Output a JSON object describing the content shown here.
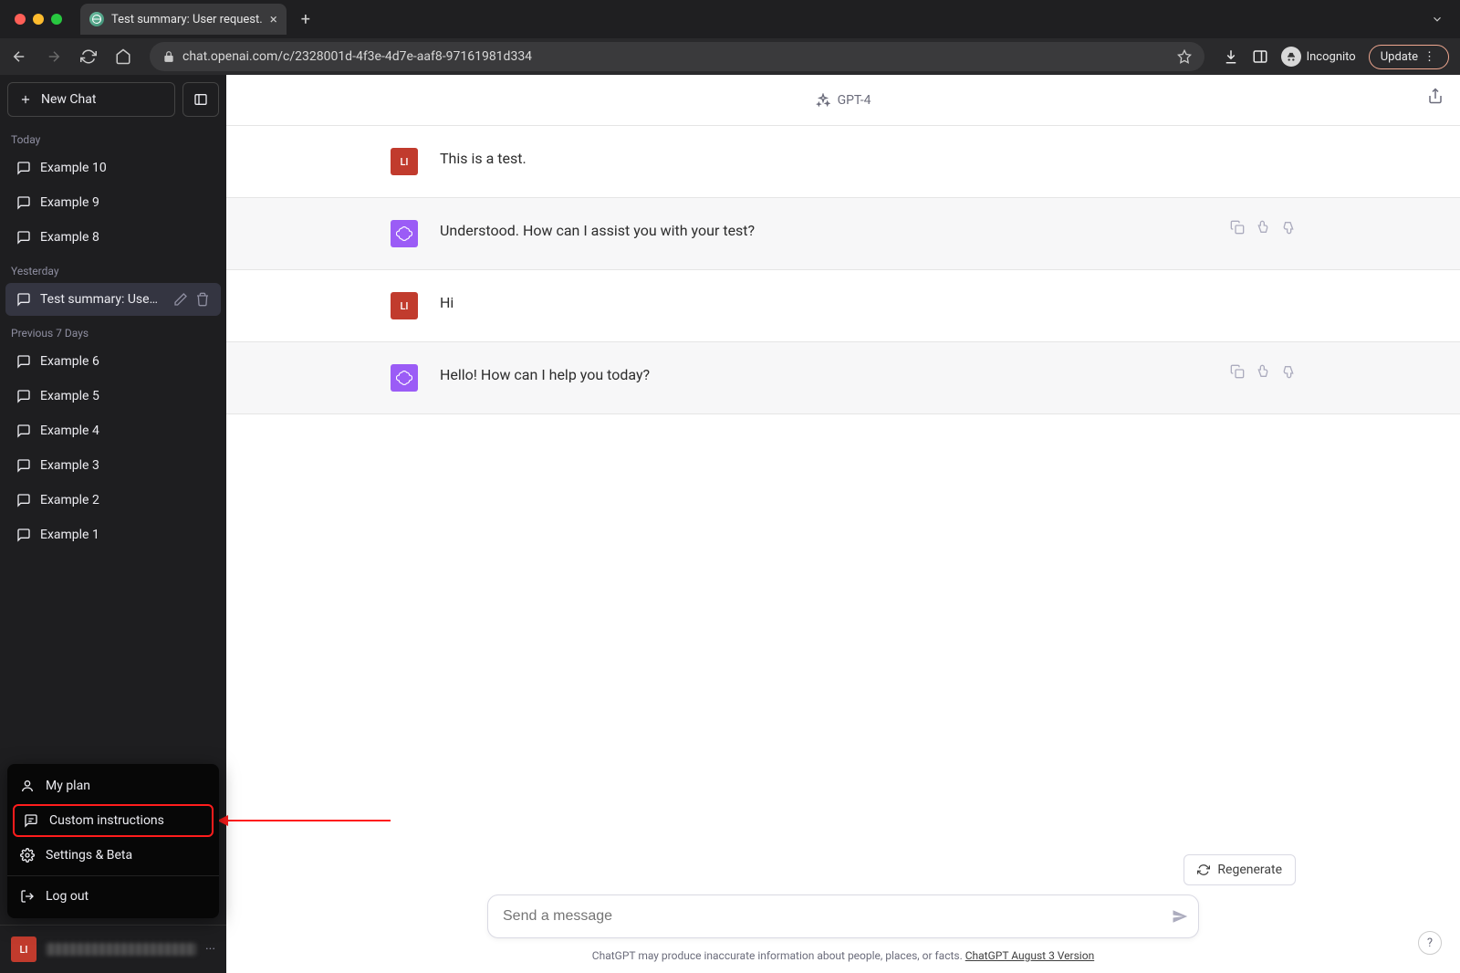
{
  "browser": {
    "tab_title": "Test summary: User request.",
    "url": "chat.openai.com/c/2328001d-4f3e-4d7e-aaf8-97161981d334",
    "incognito_label": "Incognito",
    "update_label": "Update"
  },
  "sidebar": {
    "new_chat_label": "New Chat",
    "groups": [
      {
        "label": "Today",
        "items": [
          {
            "title": "Example 10"
          },
          {
            "title": "Example 9"
          },
          {
            "title": "Example 8"
          }
        ]
      },
      {
        "label": "Yesterday",
        "items": [
          {
            "title": "Test summary: User req",
            "active": true
          }
        ]
      },
      {
        "label": "Previous 7 Days",
        "items": [
          {
            "title": "Example 6"
          },
          {
            "title": "Example 5"
          },
          {
            "title": "Example 4"
          },
          {
            "title": "Example 3"
          },
          {
            "title": "Example 2"
          },
          {
            "title": "Example 1"
          }
        ]
      }
    ],
    "profile_initials": "LI"
  },
  "popup": {
    "my_plan": "My plan",
    "custom_instructions": "Custom instructions",
    "settings": "Settings & Beta",
    "logout": "Log out"
  },
  "main": {
    "model_label": "GPT-4",
    "regenerate_label": "Regenerate",
    "composer_placeholder": "Send a message",
    "disclaimer_text": "ChatGPT may produce inaccurate information about people, places, or facts. ",
    "version_link": "ChatGPT August 3 Version"
  },
  "thread": [
    {
      "role": "user",
      "avatar": "LI",
      "text": "This is a test."
    },
    {
      "role": "ai",
      "text": "Understood. How can I assist you with your test?"
    },
    {
      "role": "user",
      "avatar": "LI",
      "text": "Hi"
    },
    {
      "role": "ai",
      "text": "Hello! How can I help you today?"
    }
  ]
}
